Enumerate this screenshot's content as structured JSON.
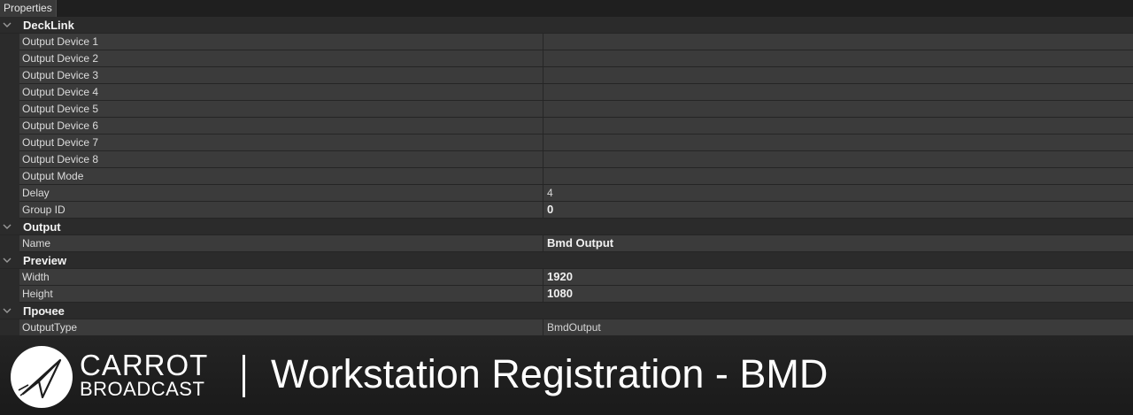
{
  "window": {
    "tab_label": "Properties"
  },
  "categories": [
    {
      "label": "DeckLink",
      "rows": [
        {
          "name": "Output Device 1",
          "value": ""
        },
        {
          "name": "Output Device 2",
          "value": ""
        },
        {
          "name": "Output Device 3",
          "value": ""
        },
        {
          "name": "Output Device 4",
          "value": ""
        },
        {
          "name": "Output Device 5",
          "value": ""
        },
        {
          "name": "Output Device 6",
          "value": ""
        },
        {
          "name": "Output Device 7",
          "value": ""
        },
        {
          "name": "Output Device 8",
          "value": ""
        },
        {
          "name": "Output Mode",
          "value": ""
        },
        {
          "name": "Delay",
          "value": "4"
        },
        {
          "name": "Group ID",
          "value": "0"
        }
      ]
    },
    {
      "label": "Output",
      "rows": [
        {
          "name": "Name",
          "value": "Bmd Output"
        }
      ]
    },
    {
      "label": "Preview",
      "rows": [
        {
          "name": "Width",
          "value": "1920"
        },
        {
          "name": "Height",
          "value": "1080"
        }
      ]
    },
    {
      "label": "Прочее",
      "rows": [
        {
          "name": "OutputType",
          "value": "BmdOutput"
        }
      ]
    }
  ],
  "footer": {
    "brand_top": "CARROT",
    "brand_bottom": "BROADCAST",
    "divider": "|",
    "title": "Workstation Registration - BMD",
    "logo_icon": "paper-plane-icon"
  }
}
